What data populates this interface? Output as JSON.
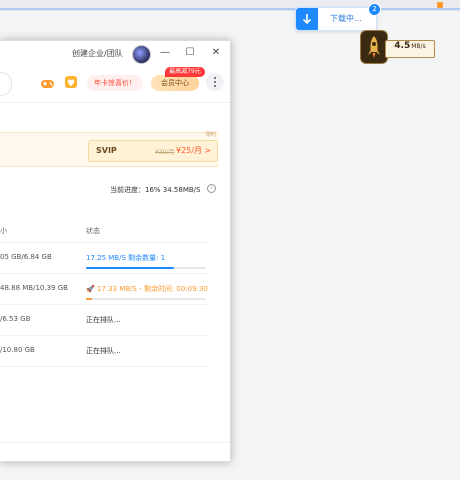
{
  "colors": {
    "accent": "#1e88ff",
    "orange": "#ff9a2e",
    "promo_red": "#ff3a3a"
  },
  "download_widget": {
    "label": "下载中...",
    "badge": "2",
    "icon": "download-arrow-icon"
  },
  "speed_widget": {
    "value": "4.5",
    "unit": "MB/s",
    "icon": "rocket-icon"
  },
  "titlebar": {
    "create_team": "创建企业/团队",
    "minimize": "—",
    "maximize": "☐",
    "close": "✕"
  },
  "toolbar": {
    "annual_card": "年卡惊喜价！",
    "promo": "最高减79元",
    "member_center": "会员中心"
  },
  "vip_banner": {
    "corner_tag": "限时",
    "label": "SVIP",
    "old_price": "¥30/月",
    "price": "¥25/月 >"
  },
  "progress": {
    "text": "当前进度：16%   34.58MB/S",
    "info": "i"
  },
  "table": {
    "headers": {
      "size": "小",
      "status": "状态"
    },
    "rows": [
      {
        "size": "05 GB/6.84 GB",
        "status": "17.25 MB/S  剩余数量: 1",
        "progress": 0.73,
        "color": "#1e88ff"
      },
      {
        "size": "48.88 MB/10.39 GB",
        "status": "17.33 MB/S - 剩余时间: 00:09:30",
        "progress": 0.05,
        "color": "#ff9a2e"
      },
      {
        "size": "/6.53 GB",
        "status": "正在排队..."
      },
      {
        "size": "/10.80 GB",
        "status": "正在排队..."
      }
    ]
  }
}
